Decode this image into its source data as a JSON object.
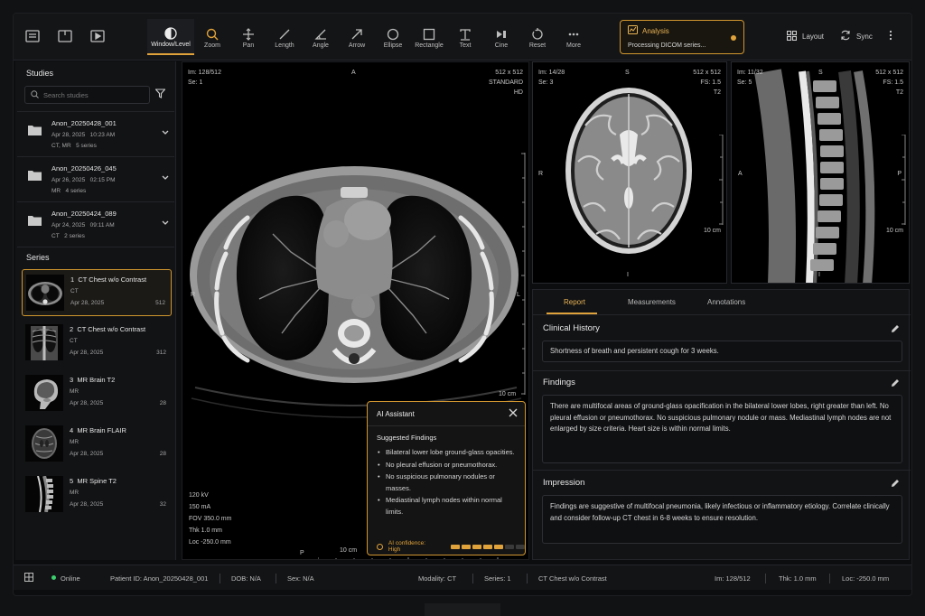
{
  "toolbar": {
    "tools": [
      {
        "label": "Window/Level",
        "icon": "contrast-icon"
      },
      {
        "label": "Zoom",
        "icon": "zoom-icon"
      },
      {
        "label": "Pan",
        "icon": "pan-icon"
      },
      {
        "label": "Length",
        "icon": "length-icon"
      },
      {
        "label": "Angle",
        "icon": "angle-icon"
      },
      {
        "label": "Arrow",
        "icon": "arrow-icon"
      },
      {
        "label": "Ellipse",
        "icon": "ellipse-icon"
      },
      {
        "label": "Rectangle",
        "icon": "rectangle-icon"
      },
      {
        "label": "Text",
        "icon": "text-icon"
      },
      {
        "label": "Cine",
        "icon": "cine-icon"
      },
      {
        "label": "Reset",
        "icon": "reset-icon"
      },
      {
        "label": "More",
        "icon": "more-icon"
      }
    ],
    "active_tool": "Window/Level",
    "analysis": {
      "title": "Analysis",
      "status": "Processing DICOM series..."
    },
    "layout_label": "Layout",
    "sync_label": "Sync",
    "accent_color": "#e0a23a"
  },
  "sidebar": {
    "studies_title": "Studies",
    "search_placeholder": "Search studies",
    "studies": [
      {
        "name": "Anon_20250428_001",
        "date": "Apr 28, 2025",
        "time": "10:23 AM",
        "modalities": "CT, MR",
        "series": "5 series"
      },
      {
        "name": "Anon_20250426_045",
        "date": "Apr 26, 2025",
        "time": "02:15 PM",
        "modalities": "MR",
        "series": "4 series"
      },
      {
        "name": "Anon_20250424_089",
        "date": "Apr 24, 2025",
        "time": "09:11 AM",
        "modalities": "CT",
        "series": "2 series"
      }
    ],
    "series_title": "Series",
    "series": [
      {
        "num": "1",
        "name": "CT Chest w/o Contrast",
        "modality": "CT",
        "date": "Apr 28, 2025",
        "count": "512"
      },
      {
        "num": "2",
        "name": "CT Chest w/o Contrast",
        "modality": "CT",
        "date": "Apr 28, 2025",
        "count": "312"
      },
      {
        "num": "3",
        "name": "MR Brain T2",
        "modality": "MR",
        "date": "Apr 28, 2025",
        "count": "28"
      },
      {
        "num": "4",
        "name": "MR Brain FLAIR",
        "modality": "MR",
        "date": "Apr 28, 2025",
        "count": "28"
      },
      {
        "num": "5",
        "name": "MR Spine T2",
        "modality": "MR",
        "date": "Apr 28, 2025",
        "count": "32"
      }
    ]
  },
  "main_view": {
    "im": "Im: 128/512",
    "se": "Se: 1",
    "matrix": "512 x 512",
    "kernel": "STANDARD",
    "hd": "HD",
    "top": "A",
    "bottom": "P",
    "left": "R",
    "right": "L",
    "scale_right": "10 cm",
    "scale_bottom": "10 cm",
    "kv": "120 kV",
    "ma": "150 mA",
    "fov": "FOV 350.0 mm",
    "thk": "Thk 1.0 mm",
    "loc": "Loc -250.0 mm"
  },
  "mr_brain": {
    "im": "Im: 14/28",
    "se": "Se: 3",
    "matrix": "512 x 512",
    "fs": "FS: 1.5",
    "seq": "T2",
    "top": "S",
    "bottom": "I",
    "left": "R",
    "scale": "10 cm"
  },
  "mr_spine": {
    "im": "Im: 11/32",
    "se": "Se: 5",
    "matrix": "512 x 512",
    "fs": "FS: 1.5",
    "seq": "T2",
    "top": "S",
    "bottom": "I",
    "left": "A",
    "right": "P",
    "scale": "10 cm"
  },
  "ai_assistant": {
    "title": "AI Assistant",
    "subtitle": "Suggested Findings",
    "findings": [
      "Bilateral lower lobe ground-glass opacities.",
      "No pleural effusion or pneumothorax.",
      "No suspicious pulmonary nodules or masses.",
      "Mediastinal lymph nodes within normal limits."
    ],
    "confidence_label": "AI confidence: High",
    "confidence_level": 0.7
  },
  "report": {
    "tabs": [
      "Report",
      "Measurements",
      "Annotations"
    ],
    "active_tab": "Report",
    "clinical_history_title": "Clinical History",
    "clinical_history": "Shortness of breath and persistent cough for 3 weeks.",
    "findings_title": "Findings",
    "findings": "There are multifocal areas of ground-glass opacification in the bilateral lower lobes, right greater than left. No pleural effusion or pneumothorax. No suspicious pulmonary nodule or mass. Mediastinal lymph nodes are not enlarged by size criteria. Heart size is within normal limits.",
    "impression_title": "Impression",
    "impression": "Findings are suggestive of multifocal pneumonia, likely infectious or inflammatory etiology. Correlate clinically and consider follow-up CT chest in 6-8 weeks to ensure resolution."
  },
  "status": {
    "online": "Online",
    "patient_id": "Patient ID:  Anon_20250428_001",
    "dob": "DOB:  N/A",
    "sex": "Sex:  N/A",
    "modality": "Modality:  CT",
    "series": "Series:  1",
    "series_name": "CT Chest w/o Contrast",
    "im": "Im:  128/512",
    "thk": "Thk:  1.0 mm",
    "loc": "Loc:  -250.0 mm"
  }
}
